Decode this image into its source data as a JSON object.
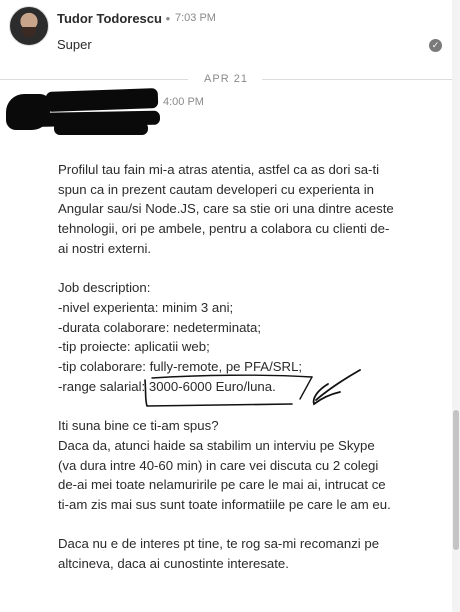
{
  "message1": {
    "sender": "Tudor Todorescu",
    "separator": "•",
    "time": "7:03 PM",
    "text": "Super",
    "read_icon": "check-circle-icon"
  },
  "date_divider": "APR 21",
  "message2": {
    "time": "4:00 PM",
    "paragraphs": [
      "Profilul tau fain mi-a atras atentia, astfel ca as dori sa-ti spun ca in prezent cautam developeri cu experienta in Angular sau/si Node.JS, care sa stie ori una dintre aceste tehnologii, ori pe ambele, pentru a colabora cu clienti de-ai nostri externi."
    ],
    "job_title": "Job description:",
    "job_lines": [
      "-nivel experienta: minim 3 ani;",
      "-durata colaborare: nedeterminata;",
      "-tip proiecte: aplicatii web;",
      "-tip colaborare: fully-remote, pe PFA/SRL;",
      "-range salarial: 3000-6000 Euro/luna."
    ],
    "question_lines": [
      "Iti suna bine ce ti-am spus?",
      "Daca da, atunci haide sa stabilim un interviu pe Skype (va dura intre 40-60 min) in care vei discuta cu 2 colegi de-ai mei toate nelamuririle pe care le mai ai, intrucat ce ti-am zis mai sus sunt toate informatiile pe care le am eu."
    ],
    "closing": "Daca nu e de interes pt tine, te rog sa-mi recomanzi pe altcineva, daca ai cunostinte interesate."
  },
  "colors": {
    "text": "#2b2b2b",
    "muted": "#8a8a8a",
    "divider": "#dcdcdc",
    "redaction": "#0a0a0a"
  }
}
